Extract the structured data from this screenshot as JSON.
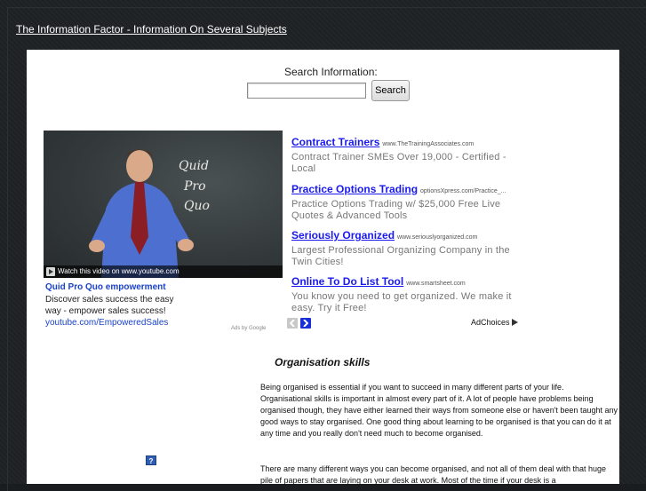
{
  "header": {
    "site_title": "The Information Factor - Information On Several Subjects"
  },
  "search": {
    "label": "Search Information:",
    "input_value": "",
    "button_label": "Search"
  },
  "video": {
    "board_words": [
      "Quid",
      "Pro",
      "Quo"
    ],
    "bar_text": "Watch this video on www.youtube.com",
    "title": "Quid Pro Quo empowerment",
    "description": "Discover sales success the easy way - empower sales success!",
    "url": "youtube.com/EmpoweredSales",
    "tail_text": "Ads by Google"
  },
  "ads": [
    {
      "title": "Contract Trainers",
      "url": "www.TheTrainingAssociates.com",
      "description": "Contract Trainer SMEs Over 19,000 - Certified - Local"
    },
    {
      "title": "Practice Options Trading",
      "url": "optionsXpress.com/Practice_...",
      "description": "Practice Options Trading w/ $25,000 Free Live Quotes & Advanced Tools"
    },
    {
      "title": "Seriously Organized",
      "url": "www.seriouslyorganized.com",
      "description": "Largest Professional Organizing Company in the Twin Cities!"
    },
    {
      "title": "Online To Do List Tool",
      "url": "www.smartsheet.com",
      "description": "You know you need to get organized. We make it easy. Try it Free!"
    }
  ],
  "ad_footer": {
    "adchoices_label": "AdChoices",
    "prev_icon": "chevron-left-icon",
    "next_icon": "chevron-right-icon"
  },
  "article": {
    "title": "Organisation skills",
    "paragraphs": [
      "Being organised is essential if you want to succeed in many different parts of your life. Organisational skills is important in almost every part of it.  A lot of people have problems being organised though, they have either learned their ways from someone else or haven't been taught any good ways to stay organised.  One good thing about learning to be organised is that you can do it at any time and you really don't need much to become organised.",
      "There are many different ways you can become organised, and not all of them deal with that huge pile of papers that are laying on your desk at work.  Most of the time if your desk is a"
    ]
  },
  "help_icon": {
    "glyph": "?"
  },
  "colors": {
    "page_bg": "#1e2123",
    "link_blue": "#1a1aee",
    "ad_desc_gray": "#777777",
    "nav_gray": "#c8c8c8",
    "nav_blue": "#1b2fd6"
  }
}
